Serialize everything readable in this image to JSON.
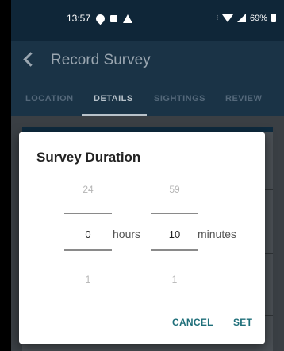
{
  "status_bar": {
    "time": "13:57",
    "battery": "69%"
  },
  "app_bar": {
    "title": "Record Survey"
  },
  "tabs": [
    {
      "label": "LOCATION",
      "active": false
    },
    {
      "label": "DETAILS",
      "active": true
    },
    {
      "label": "SIGHTINGS",
      "active": false
    },
    {
      "label": "REVIEW",
      "active": false
    }
  ],
  "dialog": {
    "title": "Survey Duration",
    "hours": {
      "above": "24",
      "value": "0",
      "below": "1",
      "unit": "hours"
    },
    "minutes": {
      "above": "59",
      "value": "10",
      "below": "1",
      "unit": "minutes"
    },
    "cancel_label": "CANCEL",
    "set_label": "SET"
  },
  "colors": {
    "accent": "#1f6f7a",
    "app_bar": "#1a3346"
  }
}
